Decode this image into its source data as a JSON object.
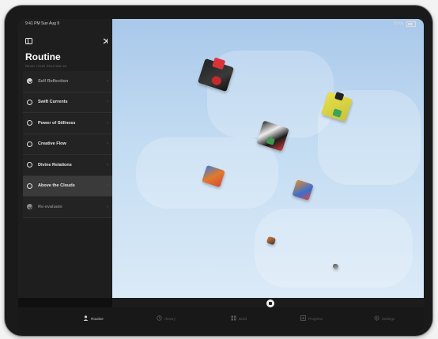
{
  "status_bar": {
    "time": "9:41 PM  Sun Aug 9",
    "battery": "100%"
  },
  "sidebar": {
    "title": "Routine",
    "subtitle": "READ YOUR ROUTINE #4",
    "top_left_icon": "sidebar-toggle-icon",
    "top_right_icon": "collapse-icon",
    "items": [
      {
        "label": "Self Reflection",
        "icon": "check-filled-icon",
        "state": "done"
      },
      {
        "label": "Swift Currents",
        "icon": "circle-icon",
        "state": "normal"
      },
      {
        "label": "Power of Stillness",
        "icon": "circle-icon",
        "state": "normal"
      },
      {
        "label": "Creative Flow",
        "icon": "circle-icon",
        "state": "normal"
      },
      {
        "label": "Divine Relations",
        "icon": "circle-icon",
        "state": "normal"
      },
      {
        "label": "Above the Clouds",
        "icon": "circle-icon",
        "state": "selected"
      },
      {
        "label": "Re-evaluate",
        "icon": "gear-icon",
        "state": "dim"
      }
    ]
  },
  "tabs": [
    {
      "label": "Routine",
      "icon": "person-icon",
      "active": true
    },
    {
      "label": "History",
      "icon": "history-icon",
      "active": false
    },
    {
      "label": "Build",
      "icon": "build-icon",
      "active": false
    },
    {
      "label": "Progress",
      "icon": "progress-icon",
      "active": false
    },
    {
      "label": "Settings",
      "icon": "settings-icon",
      "active": false
    }
  ],
  "colors": {
    "sidebar_bg": "#1e1e1e",
    "selected_row": "#3a3a3a",
    "sky_top": "#a9c8ea",
    "sky_bottom": "#dbeaf7"
  }
}
